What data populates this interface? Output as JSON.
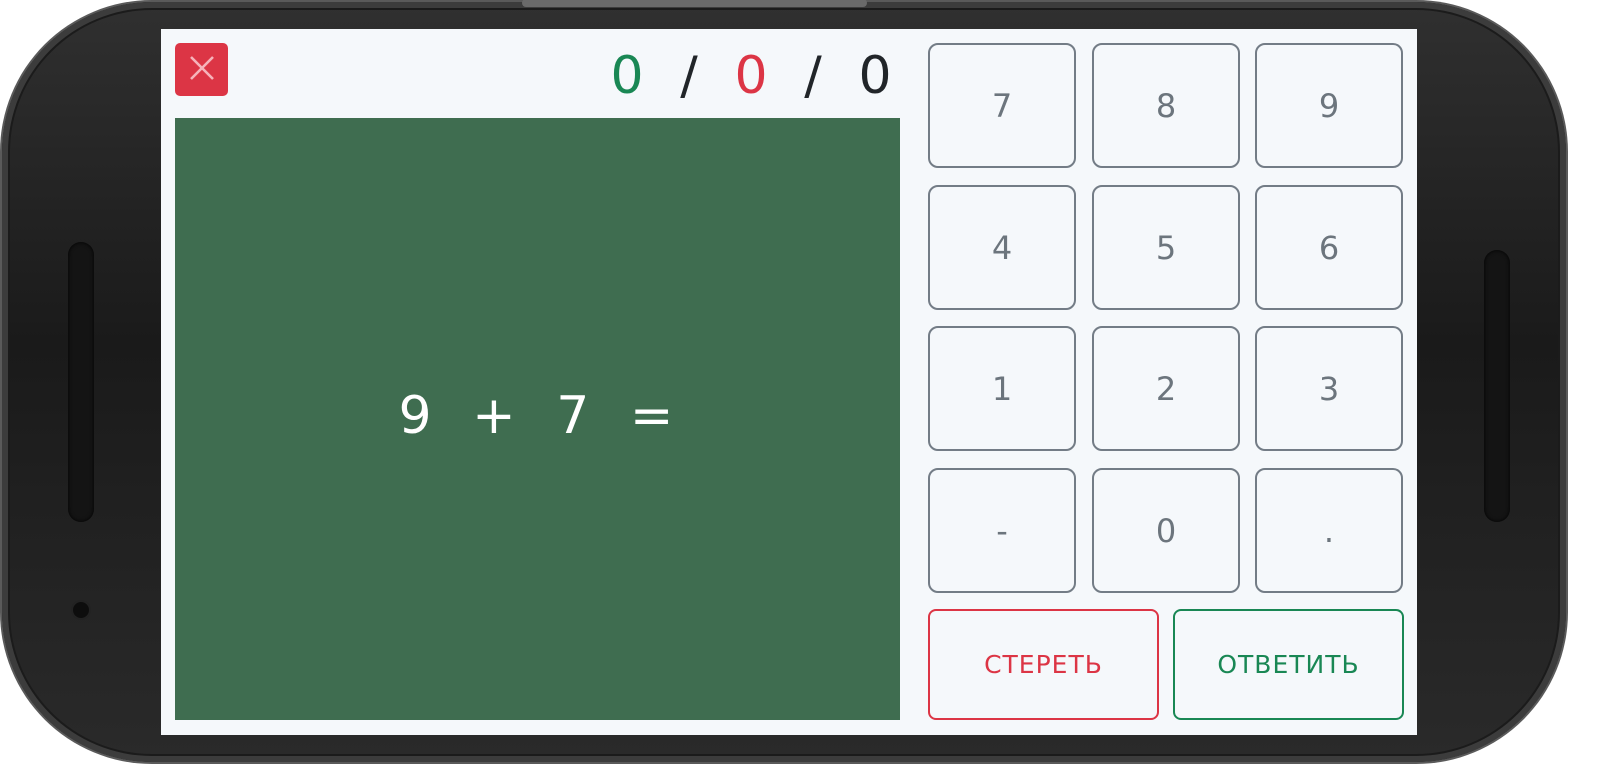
{
  "score": {
    "correct": "0",
    "separator_1": "/",
    "wrong": "0",
    "separator_2": "/",
    "total": "0",
    "correct_color": "#198754",
    "wrong_color": "#dc3545"
  },
  "board": {
    "expression": "9 + 7 =",
    "background_color": "#3f6d50"
  },
  "close_button": {
    "icon": "close-icon",
    "color": "#dc3545"
  },
  "keypad": {
    "keys": [
      "7",
      "8",
      "9",
      "4",
      "5",
      "6",
      "1",
      "2",
      "3",
      "-",
      "0",
      "."
    ]
  },
  "actions": {
    "erase_label": "СТЕРЕТЬ",
    "answer_label": "ОТВЕТИТЬ"
  }
}
